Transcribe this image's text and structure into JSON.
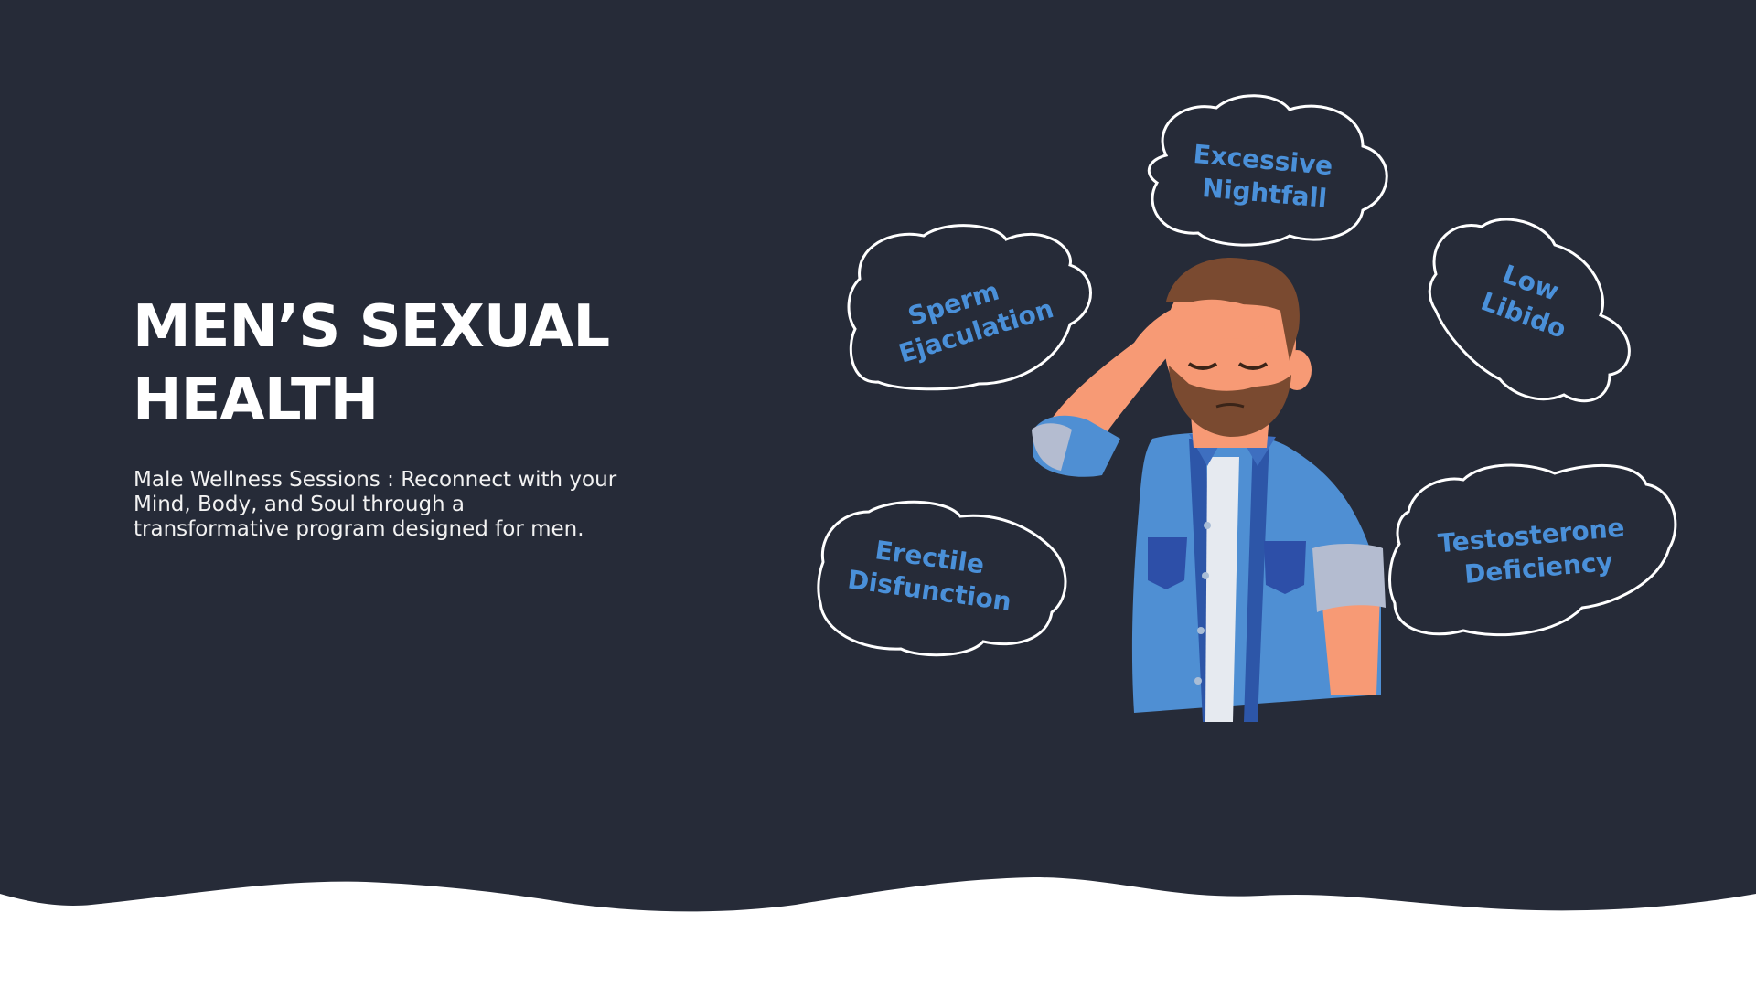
{
  "hero": {
    "title_line1": "MEN’S SEXUAL",
    "title_line2": "HEALTH",
    "subtitle_line1": "Male Wellness Sessions : Reconnect with your",
    "subtitle_line2": "Mind, Body, and Soul through a",
    "subtitle_line3": "transformative program designed for men."
  },
  "clouds": [
    {
      "line1": "Excessive",
      "line2": "Nightfall"
    },
    {
      "line1": "Sperm",
      "line2": "Ejaculation"
    },
    {
      "line1": "Low",
      "line2": "Libido"
    },
    {
      "line1": "Erectile",
      "line2": "Disfunction"
    },
    {
      "line1": "Testosterone",
      "line2": "Deficiency"
    }
  ],
  "icons": {
    "illustration": "stressed-man-icon",
    "thought": "thought-cloud-icon"
  },
  "colors": {
    "background": "#262b38",
    "accent_text": "#4a90d9",
    "title": "#ffffff",
    "shirt": "#4f8fd3",
    "skin": "#f79a75",
    "hair": "#7a4a30"
  }
}
